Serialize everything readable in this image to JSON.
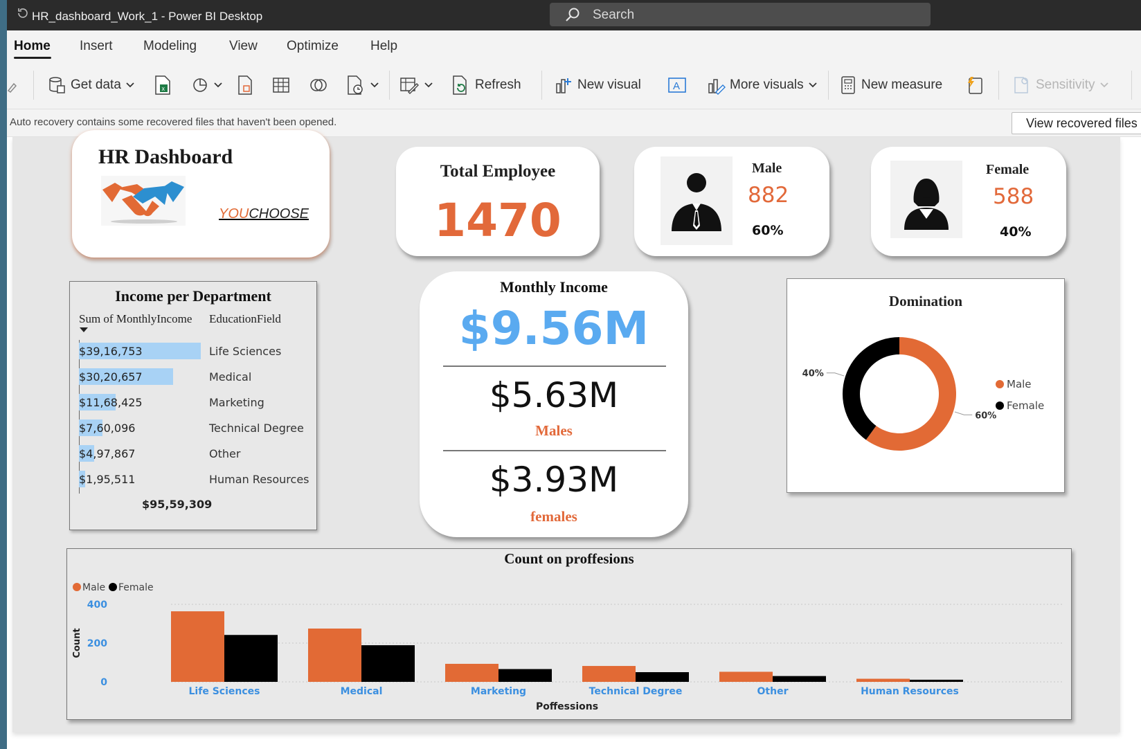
{
  "window": {
    "title": "HR_dashboard_Work_1 - Power BI Desktop"
  },
  "search": {
    "placeholder": "Search"
  },
  "menu": {
    "items": [
      "Home",
      "Insert",
      "Modeling",
      "View",
      "Optimize",
      "Help"
    ]
  },
  "ribbon": {
    "get_data": "Get data",
    "refresh": "Refresh",
    "new_visual": "New visual",
    "more_visuals": "More visuals",
    "new_measure": "New measure",
    "sensitivity": "Sensitivity"
  },
  "infobar": {
    "message": "Auto recovery contains some recovered files that haven't been opened.",
    "button": "View recovered files"
  },
  "report": {
    "hr": {
      "title": "HR Dashboard",
      "brand_part1": "YOU",
      "brand_part2": "CHOOSE"
    },
    "total_employee": {
      "title": "Total Employee",
      "value": "1470"
    },
    "male": {
      "title": "Male",
      "value": "882",
      "pct": "60%"
    },
    "female": {
      "title": "Female",
      "value": "588",
      "pct": "40%"
    },
    "income_dept": {
      "title": "Income per Department",
      "col1": "Sum of MonthlyIncome",
      "col2": "EducationField",
      "rows": [
        {
          "value": "$39,16,753",
          "name": "Life Sciences",
          "amount": 3916753
        },
        {
          "value": "$30,20,657",
          "name": "Medical",
          "amount": 3020657
        },
        {
          "value": "$11,68,425",
          "name": "Marketing",
          "amount": 1168425
        },
        {
          "value": "$7,60,096",
          "name": "Technical Degree",
          "amount": 760096
        },
        {
          "value": "$4,97,867",
          "name": "Other",
          "amount": 497867
        },
        {
          "value": "$1,95,511",
          "name": "Human Resources",
          "amount": 195511
        }
      ],
      "total": "$95,59,309"
    },
    "monthly_income": {
      "title": "Monthly Income",
      "total": "$9.56M",
      "male_value": "$5.63M",
      "male_label": "Males",
      "female_value": "$3.93M",
      "female_label": "females"
    }
  },
  "colors": {
    "male": "#e26a35",
    "female": "#000000",
    "bar_light": "#a8d2f5",
    "accent_blue": "#5aaaf0"
  },
  "chart_data": [
    {
      "type": "pie",
      "title": "Domination",
      "donut": true,
      "categories": [
        "Male",
        "Female"
      ],
      "values": [
        60,
        40
      ],
      "labels": [
        "60%",
        "40%"
      ],
      "legend": "right"
    },
    {
      "type": "bar",
      "title": "Count on proffesions",
      "xlabel": "Poffessions",
      "ylabel": "Count",
      "categories": [
        "Life Sciences",
        "Medical",
        "Marketing",
        "Technical Degree",
        "Other",
        "Human Resources"
      ],
      "series": [
        {
          "name": "Male",
          "values": [
            364,
            275,
            93,
            82,
            52,
            16
          ]
        },
        {
          "name": "Female",
          "values": [
            242,
            189,
            66,
            50,
            30,
            11
          ]
        }
      ],
      "ylim": [
        0,
        400
      ],
      "yticks": [
        "0",
        "200",
        "400"
      ],
      "legend": "top-left",
      "grid": true
    }
  ]
}
